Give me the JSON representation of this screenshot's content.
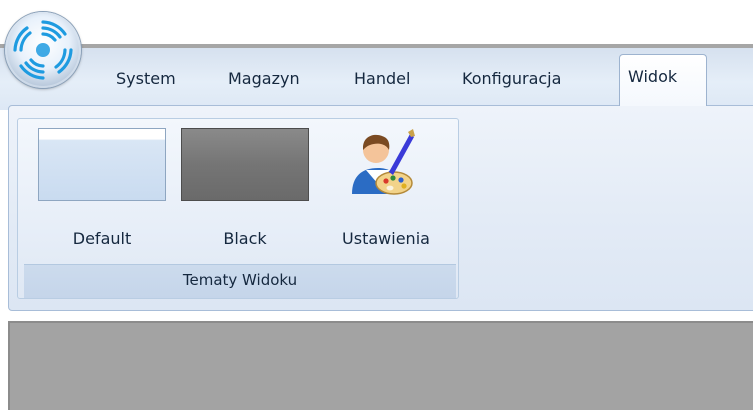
{
  "tabs": [
    {
      "label": "System"
    },
    {
      "label": "Magazyn"
    },
    {
      "label": "Handel"
    },
    {
      "label": "Konfiguracja"
    },
    {
      "label": "Widok",
      "active": true
    }
  ],
  "ribbon": {
    "group": {
      "caption": "Tematy Widoku",
      "buttons": [
        {
          "label": "Default",
          "icon": "theme-default-preview"
        },
        {
          "label": "Black",
          "icon": "theme-black-preview"
        },
        {
          "label": "Ustawienia",
          "icon": "user-palette-icon"
        }
      ]
    }
  },
  "orb": {
    "icon": "application-orb-icon"
  },
  "colors": {
    "ribbon_bg": "#e3ebf6",
    "tab_strip_bg": "#dde8f5",
    "group_caption_bg": "#c5d5ea",
    "work_area_bg": "#a3a3a3",
    "text": "#15283f"
  }
}
